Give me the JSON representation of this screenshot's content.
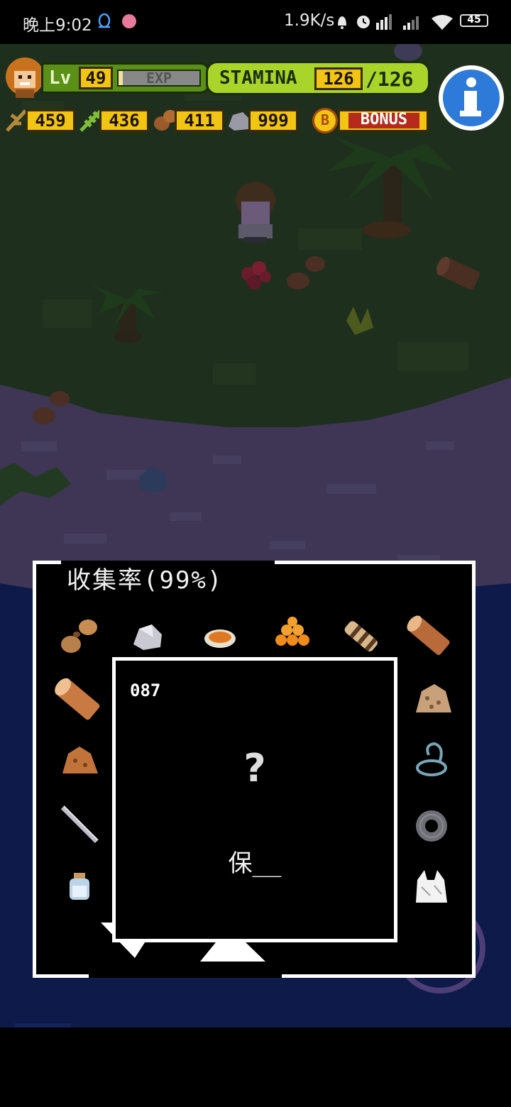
{
  "status_bar": {
    "time": "晚上9:02",
    "net_speed": "1.9K/s",
    "battery": "45"
  },
  "hud": {
    "level_label": "Lv",
    "level": "49",
    "exp_label": "EXP",
    "exp_fraction": 0.05,
    "stamina_label": "STAMINA",
    "stamina_current": "126",
    "stamina_max": "/126",
    "resources": [
      {
        "icon": "branch-icon",
        "value": "459"
      },
      {
        "icon": "leaf-icon",
        "value": "436"
      },
      {
        "icon": "acorn-icon",
        "value": "411"
      },
      {
        "icon": "stone-icon",
        "value": "999"
      }
    ],
    "bonus_label": "BONUS",
    "bonus_badge": "B",
    "info_icon": "info-icon"
  },
  "collection": {
    "title": "收集率(99%)",
    "detail_number": "087",
    "detail_unknown": "?",
    "detail_name": "保__",
    "items": [
      "nuts-icon",
      "stone-icon",
      "soup-bowl-icon",
      "orange-pile-icon",
      "striped-log-icon",
      "log-icon",
      "log-icon",
      "dirt-pile-icon",
      "clay-pile-icon",
      "rope-icon",
      "stick-icon",
      "tire-icon",
      "bottle-icon",
      "plastic-bag-icon"
    ]
  },
  "colors": {
    "grass": "#1f2f1e",
    "sand": "#3e3654",
    "sea": "#0d1a4a",
    "hud_green": "#8fcf2a",
    "hud_yellow": "#f2c413",
    "info_blue": "#2d7ad8"
  }
}
